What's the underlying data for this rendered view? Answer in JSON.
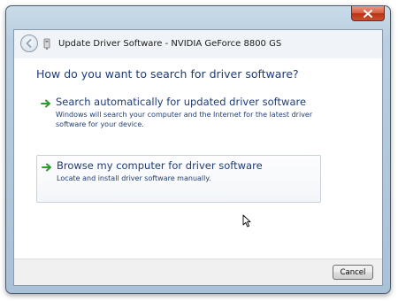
{
  "window": {
    "title": "Update Driver Software - NVIDIA GeForce 8800 GS"
  },
  "main": {
    "question": "How do you want to search for driver software?",
    "options": [
      {
        "title": "Search automatically for updated driver software",
        "description": "Windows will search your computer and the Internet for the latest driver software for your device.",
        "icon": "green-arrow-icon"
      },
      {
        "title": "Browse my computer for driver software",
        "description": "Locate and install driver software manually.",
        "icon": "green-arrow-icon"
      }
    ]
  },
  "footer": {
    "cancel_label": "Cancel"
  },
  "colors": {
    "link_text": "#1f3c76",
    "arrow_green": "#2e9a2e",
    "close_red": "#c9502e"
  }
}
